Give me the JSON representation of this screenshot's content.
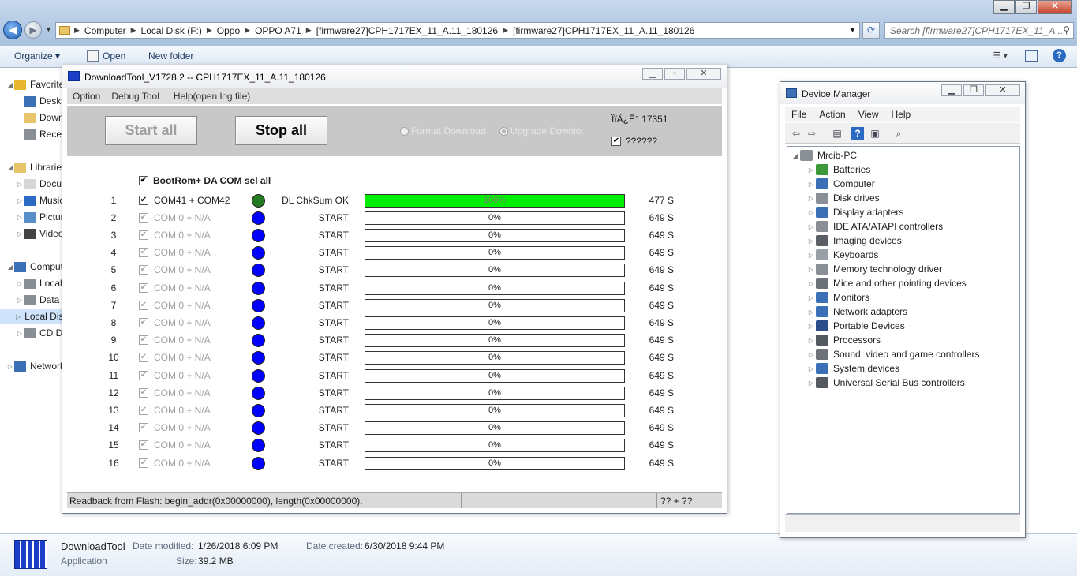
{
  "explorer": {
    "breadcrumbs": [
      "Computer",
      "Local Disk (F:)",
      "Oppo",
      "OPPO A71",
      "[firmware27]CPH1717EX_11_A.11_180126",
      "[firmware27]CPH1717EX_11_A.11_180126"
    ],
    "search_placeholder": "Search [firmware27]CPH1717EX_11_A....",
    "toolbar": {
      "organize": "Organize ▾",
      "open": "Open",
      "new_folder": "New folder"
    },
    "nav": [
      {
        "label": "Favorites",
        "expander": "◢"
      },
      {
        "label": "Desktop"
      },
      {
        "label": "Downloads"
      },
      {
        "label": "Recent Places"
      },
      {
        "label": "Libraries",
        "expander": "◢"
      },
      {
        "label": "Documents",
        "expander": "▷"
      },
      {
        "label": "Music",
        "expander": "▷"
      },
      {
        "label": "Pictures",
        "expander": "▷"
      },
      {
        "label": "Videos",
        "expander": "▷"
      },
      {
        "label": "Computer",
        "expander": "◢"
      },
      {
        "label": "Local Disk (C:)",
        "expander": "▷"
      },
      {
        "label": "Data (E:)",
        "expander": "▷"
      },
      {
        "label": "Local Disk (F:)",
        "expander": "▷"
      },
      {
        "label": "CD Drive",
        "expander": "▷"
      },
      {
        "label": "Network",
        "expander": "▷"
      }
    ],
    "details": {
      "name": "DownloadTool",
      "type": "Application",
      "modified_label": "Date modified:",
      "modified": "1/26/2018 6:09 PM",
      "size_label": "Size:",
      "size": "39.2 MB",
      "created_label": "Date created:",
      "created": "6/30/2018 9:44 PM"
    }
  },
  "downloadtool": {
    "title": "DownloadTool_V1728.2 -- CPH1717EX_11_A.11_180126",
    "menu": [
      "Option",
      "Debug TooL",
      "Help(open log file)"
    ],
    "start_all": "Start all",
    "stop_all": "Stop all",
    "radio_format": "Format Download",
    "radio_upgrade": "Upgrade Downlo:",
    "top_code": "ÏïÄ¿Ê° 17351",
    "top_check_label": "??????",
    "select_all": "BootRom+ DA COM sel all",
    "rows": [
      {
        "num": "1",
        "port": "COM41 + COM42",
        "status": "DL ChkSum OK",
        "progress": "100%",
        "progress_frac": 1.0,
        "time": "477 S",
        "active": true
      },
      {
        "num": "2",
        "port": "COM 0 + N/A",
        "status": "START",
        "progress": "0%",
        "progress_frac": 0,
        "time": "649 S",
        "active": false
      },
      {
        "num": "3",
        "port": "COM 0 + N/A",
        "status": "START",
        "progress": "0%",
        "progress_frac": 0,
        "time": "649 S",
        "active": false
      },
      {
        "num": "4",
        "port": "COM 0 + N/A",
        "status": "START",
        "progress": "0%",
        "progress_frac": 0,
        "time": "649 S",
        "active": false
      },
      {
        "num": "5",
        "port": "COM 0 + N/A",
        "status": "START",
        "progress": "0%",
        "progress_frac": 0,
        "time": "649 S",
        "active": false
      },
      {
        "num": "6",
        "port": "COM 0 + N/A",
        "status": "START",
        "progress": "0%",
        "progress_frac": 0,
        "time": "649 S",
        "active": false
      },
      {
        "num": "7",
        "port": "COM 0 + N/A",
        "status": "START",
        "progress": "0%",
        "progress_frac": 0,
        "time": "649 S",
        "active": false
      },
      {
        "num": "8",
        "port": "COM 0 + N/A",
        "status": "START",
        "progress": "0%",
        "progress_frac": 0,
        "time": "649 S",
        "active": false
      },
      {
        "num": "9",
        "port": "COM 0 + N/A",
        "status": "START",
        "progress": "0%",
        "progress_frac": 0,
        "time": "649 S",
        "active": false
      },
      {
        "num": "10",
        "port": "COM 0 + N/A",
        "status": "START",
        "progress": "0%",
        "progress_frac": 0,
        "time": "649 S",
        "active": false
      },
      {
        "num": "11",
        "port": "COM 0 + N/A",
        "status": "START",
        "progress": "0%",
        "progress_frac": 0,
        "time": "649 S",
        "active": false
      },
      {
        "num": "12",
        "port": "COM 0 + N/A",
        "status": "START",
        "progress": "0%",
        "progress_frac": 0,
        "time": "649 S",
        "active": false
      },
      {
        "num": "13",
        "port": "COM 0 + N/A",
        "status": "START",
        "progress": "0%",
        "progress_frac": 0,
        "time": "649 S",
        "active": false
      },
      {
        "num": "14",
        "port": "COM 0 + N/A",
        "status": "START",
        "progress": "0%",
        "progress_frac": 0,
        "time": "649 S",
        "active": false
      },
      {
        "num": "15",
        "port": "COM 0 + N/A",
        "status": "START",
        "progress": "0%",
        "progress_frac": 0,
        "time": "649 S",
        "active": false
      },
      {
        "num": "16",
        "port": "COM 0 + N/A",
        "status": "START",
        "progress": "0%",
        "progress_frac": 0,
        "time": "649 S",
        "active": false
      }
    ],
    "status_bar": {
      "left": "Readback from Flash:  begin_addr(0x00000000), length(0x00000000).",
      "right": "?? + ??"
    },
    "colors": {
      "progress_fill": "#00ee00",
      "dot_active": "#227a22",
      "dot_idle": "#0000ff"
    }
  },
  "device_manager": {
    "title": "Device Manager",
    "menu": [
      "File",
      "Action",
      "View",
      "Help"
    ],
    "root": "Mrcib-PC",
    "categories": [
      {
        "label": "Batteries",
        "icon": "battery-icon",
        "color": "#3a9a3a"
      },
      {
        "label": "Computer",
        "icon": "computer-icon",
        "color": "#3b6fb6"
      },
      {
        "label": "Disk drives",
        "icon": "disk-icon",
        "color": "#8a8f96"
      },
      {
        "label": "Display adapters",
        "icon": "display-icon",
        "color": "#3b6fb6"
      },
      {
        "label": "IDE ATA/ATAPI controllers",
        "icon": "ide-icon",
        "color": "#8a8f96"
      },
      {
        "label": "Imaging devices",
        "icon": "camera-icon",
        "color": "#5a5f66"
      },
      {
        "label": "Keyboards",
        "icon": "keyboard-icon",
        "color": "#9aa0a8"
      },
      {
        "label": "Memory technology driver",
        "icon": "memory-icon",
        "color": "#8a8f96"
      },
      {
        "label": "Mice and other pointing devices",
        "icon": "mouse-icon",
        "color": "#6d7279"
      },
      {
        "label": "Monitors",
        "icon": "monitor-icon",
        "color": "#3b6fb6"
      },
      {
        "label": "Network adapters",
        "icon": "network-icon",
        "color": "#3b6fb6"
      },
      {
        "label": "Portable Devices",
        "icon": "portable-icon",
        "color": "#2b4d8a"
      },
      {
        "label": "Processors",
        "icon": "cpu-icon",
        "color": "#555a60"
      },
      {
        "label": "Sound, video and game controllers",
        "icon": "speaker-icon",
        "color": "#6d7279"
      },
      {
        "label": "System devices",
        "icon": "system-icon",
        "color": "#3b6fb6"
      },
      {
        "label": "Universal Serial Bus controllers",
        "icon": "usb-icon",
        "color": "#555a60"
      }
    ]
  }
}
